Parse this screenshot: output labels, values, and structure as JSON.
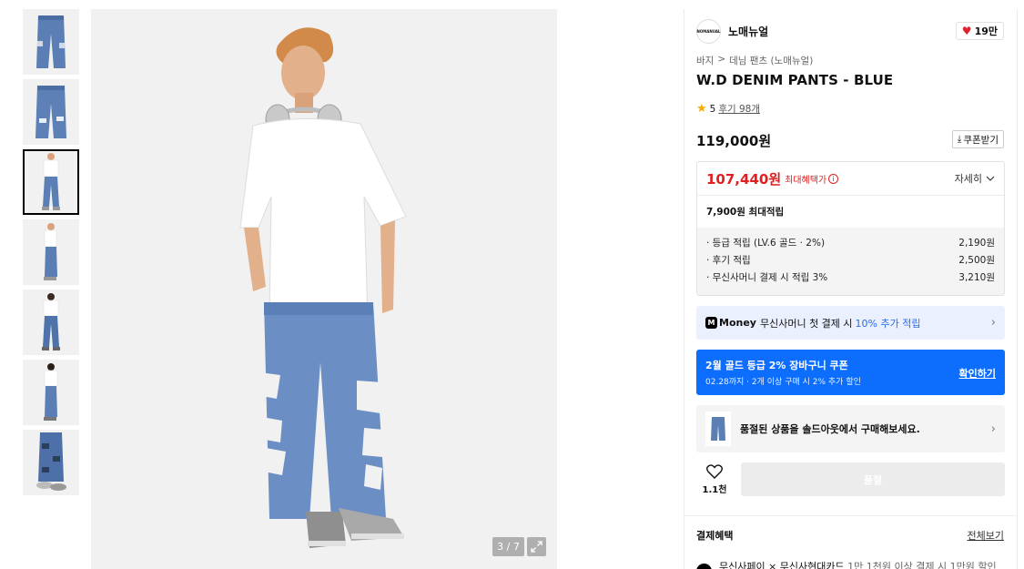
{
  "gallery": {
    "pager": "3 / 7",
    "thumbnails": [
      "pants-front",
      "pants-back",
      "model-front",
      "model-side",
      "model-front-2",
      "model-back",
      "pants-detail"
    ],
    "active_index": 2
  },
  "brand": {
    "name": "노매뉴얼",
    "logo_text": "NOMANUAL"
  },
  "likes": {
    "count": "19만"
  },
  "breadcrumb": [
    "바지",
    ">",
    "데님 팬츠 (노매뉴얼)"
  ],
  "product": {
    "title": "W.D DENIM PANTS - BLUE",
    "rating": "5",
    "reviews": "후기 98개",
    "price": "119,000원",
    "coupon_button": "쿠폰받기"
  },
  "benefit": {
    "sale_price": "107,440원",
    "max_benefit_label": "최대혜택가",
    "detail_label": "자세히",
    "max_points": "7,900원 최대적립",
    "items": [
      {
        "label": "· 등급 적립 (LV.6 골드 · 2%)",
        "value": "2,190원"
      },
      {
        "label": "· 후기 적립",
        "value": "2,500원"
      },
      {
        "label": "· 무신사머니 결제 시 적립 3%",
        "value": "3,210원"
      }
    ]
  },
  "money": {
    "logo": "M",
    "brand": "Money",
    "text": "무신사머니 첫 결제 시",
    "accent": "10% 추가 적립"
  },
  "coupon_banner": {
    "title": "2월 골드 등급 2% 장바구니 쿠폰",
    "subtitle": "02.28까지 · 2개 이상 구매 시 2% 추가 할인",
    "link": "확인하기"
  },
  "soldout_notice": {
    "text": "품절된 상품을 솔드아웃에서 구매해보세요."
  },
  "wishlist": {
    "count": "1.1천"
  },
  "buy_button": {
    "label": "품절"
  },
  "payment": {
    "title": "결제혜택",
    "see_all": "전체보기",
    "line_bold": "무신사페이 × 무신사현대카드",
    "line_rest": "1만 1천원 이상 결제 시 1만원 할인"
  },
  "colors": {
    "accent_blue": "#0d6efd",
    "sale_red": "#e02020",
    "money_bg": "#eaf0fd",
    "star": "#f6a800"
  }
}
